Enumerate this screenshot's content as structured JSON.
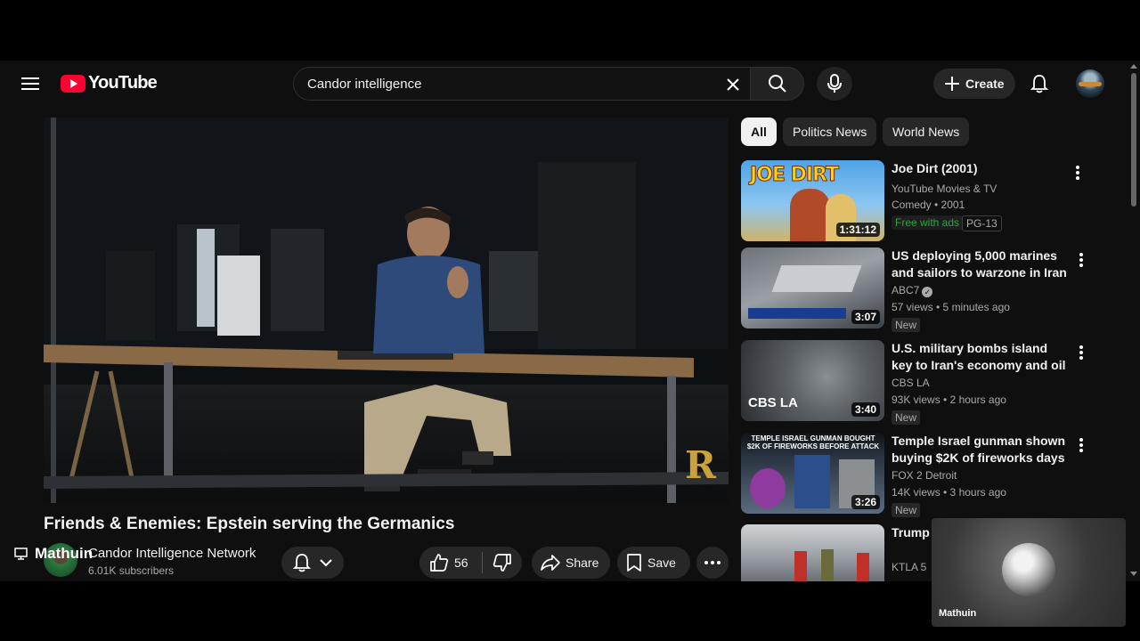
{
  "header": {
    "logo_text": "YouTube",
    "search_value": "Candor intelligence",
    "create_label": "Create"
  },
  "video": {
    "title": "Friends & Enemies: Epstein serving the Germanics",
    "channel_name": "Candor Intelligence Network",
    "subscribers": "6.01K subscribers",
    "likes": "56",
    "share_label": "Share",
    "save_label": "Save",
    "watermark": "R"
  },
  "overlay_user": "Mathuin",
  "chips": [
    "All",
    "Politics News",
    "World News"
  ],
  "recommendations": [
    {
      "title": "Joe Dirt (2001)",
      "channel": "YouTube Movies & TV",
      "meta": "Comedy • 2001",
      "badge": "Free with ads",
      "rating": "PG-13",
      "duration": "1:31:12",
      "thumb_text": "JOE DIRT"
    },
    {
      "title": "US deploying 5,000 marines and sailors to warzone in Iran as ...",
      "channel": "ABC7",
      "meta": "57 views • 5 minutes ago",
      "badge": "New",
      "duration": "3:07"
    },
    {
      "title": "U.S. military bombs island key to Iran's economy and oil ...",
      "channel": "CBS LA",
      "meta": "93K views • 2 hours ago",
      "badge": "New",
      "duration": "3:40",
      "thumb_text": "CBS LA"
    },
    {
      "title": "Temple Israel gunman shown buying $2K of fireworks days ...",
      "channel": "FOX 2 Detroit",
      "meta": "14K views • 3 hours ago",
      "badge": "New",
      "duration": "3:26",
      "thumb_text": "TEMPLE ISRAEL GUNMAN BOUGHT $2K OF FIREWORKS BEFORE ATTACK"
    },
    {
      "title": "Trump s... military...",
      "channel": "KTLA 5"
    }
  ],
  "webcam_name": "Mathuin"
}
